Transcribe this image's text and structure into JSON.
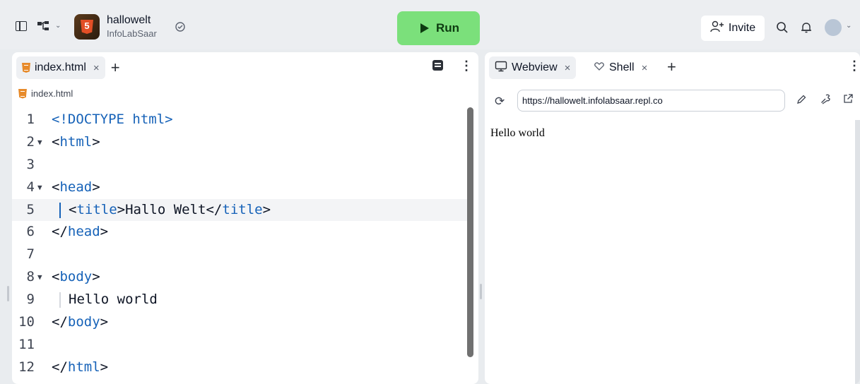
{
  "topbar": {
    "project_name": "hallowelt",
    "project_owner": "InfoLabSaar",
    "project_logo_text": "5",
    "run_label": "Run",
    "invite_label": "Invite"
  },
  "editor": {
    "tab_label": "index.html",
    "tab_close": "×",
    "breadcrumb": "index.html",
    "lines": [
      {
        "n": "1",
        "fold": false,
        "text": "<!DOCTYPE html>"
      },
      {
        "n": "2",
        "fold": true,
        "text": "<html>"
      },
      {
        "n": "3",
        "fold": false,
        "text": ""
      },
      {
        "n": "4",
        "fold": true,
        "text": "<head>"
      },
      {
        "n": "5",
        "fold": false,
        "text": "<title>Hallo Welt</title>",
        "indent": true,
        "current": true
      },
      {
        "n": "6",
        "fold": false,
        "text": "</head>"
      },
      {
        "n": "7",
        "fold": false,
        "text": ""
      },
      {
        "n": "8",
        "fold": true,
        "text": "<body>"
      },
      {
        "n": "9",
        "fold": false,
        "text": "Hello world",
        "indent": true
      },
      {
        "n": "10",
        "fold": false,
        "text": "</body>"
      },
      {
        "n": "11",
        "fold": false,
        "text": ""
      },
      {
        "n": "12",
        "fold": false,
        "text": "</html>"
      }
    ]
  },
  "preview": {
    "tabs": [
      {
        "label": "Webview",
        "close": "×"
      },
      {
        "label": "Shell",
        "close": "×"
      }
    ],
    "url": "https://hallowelt.infolabsaar.repl.co",
    "content": "Hello world"
  },
  "colors": {
    "run_bg": "#7be07b",
    "accent_blue": "#1662b8",
    "html_orange": "#e78a2a"
  }
}
